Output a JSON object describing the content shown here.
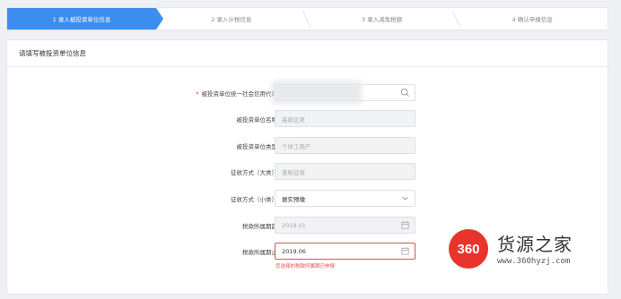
{
  "steps": [
    {
      "label": "1 录入被投资单位信息",
      "active": true
    },
    {
      "label": "2 录入计税信息",
      "active": false
    },
    {
      "label": "3 录入减免税额",
      "active": false
    },
    {
      "label": "4 确认申报信息",
      "active": false
    }
  ],
  "panel": {
    "title": "请填写被投资单位信息",
    "fields": {
      "credit_code": {
        "label": "被投资单位统一社会信用代码",
        "value": "",
        "required": true,
        "icon": "search-icon"
      },
      "unit_name": {
        "label": "被投资单位名称",
        "value": "高新区君"
      },
      "unit_type": {
        "label": "被投资单位类型",
        "value": "个体工商户"
      },
      "collect_major": {
        "label": "征收方式（大类）",
        "value": "查账征收"
      },
      "collect_minor": {
        "label": "征收方式（小类）",
        "value": "据实预缴",
        "icon": "chevron-down-icon"
      },
      "period_start": {
        "label": "税款所属期起",
        "value": "2019.01",
        "icon": "calendar-icon"
      },
      "period_end": {
        "label": "税款所属期止",
        "value": "2019.06",
        "icon": "calendar-icon",
        "error": "您选择的税款所属期已申报"
      }
    }
  },
  "watermark": {
    "logo_text": "360",
    "title": "货源之家",
    "url": "www.360hyzj.com"
  },
  "colors": {
    "accent": "#3b8ef0",
    "error": "#e0504a",
    "required": "#e22233"
  }
}
